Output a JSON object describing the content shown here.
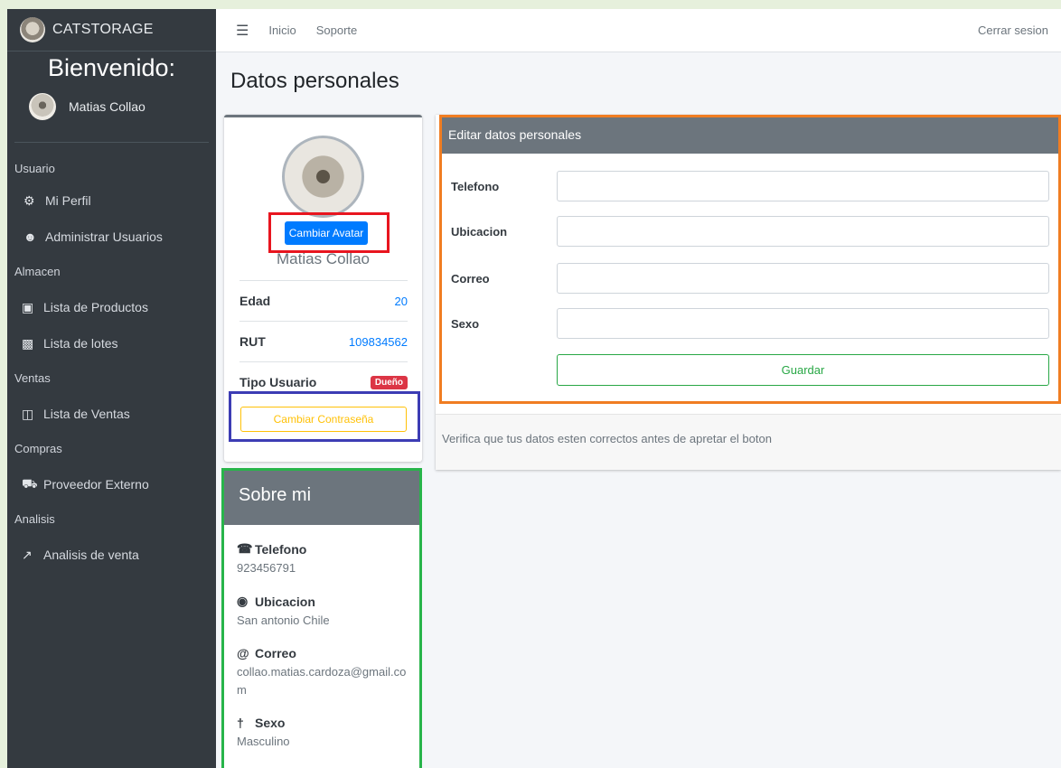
{
  "sidebar": {
    "brand": "CATSTORAGE",
    "welcome": "Bienvenido:",
    "user_name": "Matias Collao",
    "sections": [
      {
        "header": "Usuario",
        "items": [
          {
            "label": "Mi Perfil",
            "icon": "user-cog-icon"
          },
          {
            "label": "Administrar Usuarios",
            "icon": "users-icon"
          }
        ]
      },
      {
        "header": "Almacen",
        "items": [
          {
            "label": "Lista de Productos",
            "icon": "boxes-icon"
          },
          {
            "label": "Lista de lotes",
            "icon": "cubes-icon"
          }
        ]
      },
      {
        "header": "Ventas",
        "items": [
          {
            "label": "Lista de Ventas",
            "icon": "receipt-icon"
          }
        ]
      },
      {
        "header": "Compras",
        "items": [
          {
            "label": "Proveedor Externo",
            "icon": "truck-icon"
          }
        ]
      },
      {
        "header": "Analisis",
        "items": [
          {
            "label": "Analisis de venta",
            "icon": "chart-line-icon"
          }
        ]
      }
    ]
  },
  "topbar": {
    "links": [
      "Inicio",
      "Soporte"
    ],
    "logout": "Cerrar sesion"
  },
  "page": {
    "title": "Datos personales"
  },
  "profile": {
    "avatar_button": "Cambiar Avatar",
    "name": "Matias Collao",
    "rows": [
      {
        "label": "Edad",
        "value": "20"
      },
      {
        "label": "RUT",
        "value": "109834562"
      },
      {
        "label": "Tipo Usuario",
        "badge": "Dueño"
      }
    ],
    "password_button": "Cambiar Contraseña"
  },
  "about": {
    "title": "Sobre mi",
    "items": [
      {
        "label": "Telefono",
        "value": "923456791",
        "icon": "phone-icon"
      },
      {
        "label": "Ubicacion",
        "value": "San antonio Chile",
        "icon": "map-marker-icon"
      },
      {
        "label": "Correo",
        "value": "collao.matias.cardoza@gmail.com",
        "icon": "at-icon"
      },
      {
        "label": "Sexo",
        "value": "Masculino",
        "icon": "person-icon"
      }
    ]
  },
  "edit": {
    "title": "Editar datos personales",
    "fields": [
      {
        "label": "Telefono",
        "value": ""
      },
      {
        "label": "Ubicacion",
        "value": ""
      },
      {
        "label": "Correo",
        "value": ""
      },
      {
        "label": "Sexo",
        "value": ""
      }
    ],
    "save_button": "Guardar",
    "note": "Verifica que tus datos esten correctos antes de apretar el boton"
  },
  "colors": {
    "sidebar": "#343a40",
    "primary": "#007bff",
    "warning": "#ffc107",
    "success": "#28a745",
    "danger": "#dc3545",
    "header_gray": "#6c757d"
  }
}
